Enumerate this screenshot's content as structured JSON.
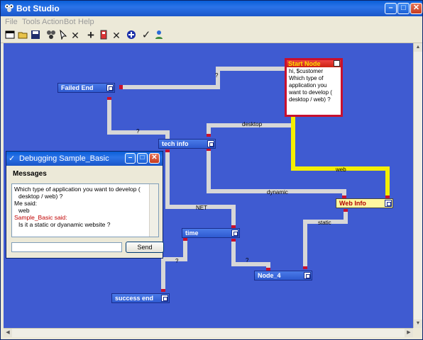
{
  "app": {
    "title": "Bot Studio"
  },
  "menu": [
    "File",
    "Tools",
    "Action",
    "Bot",
    "Help"
  ],
  "toolbar_icons": [
    "new-icon",
    "open-icon",
    "save-icon",
    "bot-icon",
    "cursor-icon",
    "delete-icon",
    "add-node-icon",
    "node-icon",
    "remove-node-icon",
    "add-link-icon",
    "check-icon",
    "user-icon"
  ],
  "nodes": {
    "start": {
      "title": "Start Node",
      "text": "hi, $customer Which type of application you want to develop ( desktop / web) ?"
    },
    "failed_end": "Failed End",
    "tech_info": "tech info",
    "web_info": "Web Info",
    "time": "time",
    "node4": "Node_4",
    "success_end": "success end"
  },
  "edges": {
    "q1": "?",
    "q2": "?",
    "desktop": "desktop",
    "web": "web",
    "dynamic": "dynamic",
    "net": "NET",
    "static": "static",
    "q3": "?",
    "q4": "?"
  },
  "debug": {
    "title": "Debugging Sample_Basic",
    "messages_label": "Messages",
    "lines": [
      {
        "text": "Which type of application you want to develop (",
        "cls": ""
      },
      {
        "text": "desktop / web) ?",
        "cls": "ind"
      },
      {
        "text": "Me said:",
        "cls": ""
      },
      {
        "text": "web",
        "cls": "ind"
      },
      {
        "text": "Sample_Basic said:",
        "cls": "red"
      },
      {
        "text": "Is it a static or dyanamic website ?",
        "cls": "ind"
      }
    ],
    "input_value": "",
    "send_label": "Send"
  },
  "colors": {
    "canvas": "#3f5bd1",
    "edge": "#d7d7d7",
    "active_edge": "#f4ee00",
    "start_border": "#c8102e"
  }
}
